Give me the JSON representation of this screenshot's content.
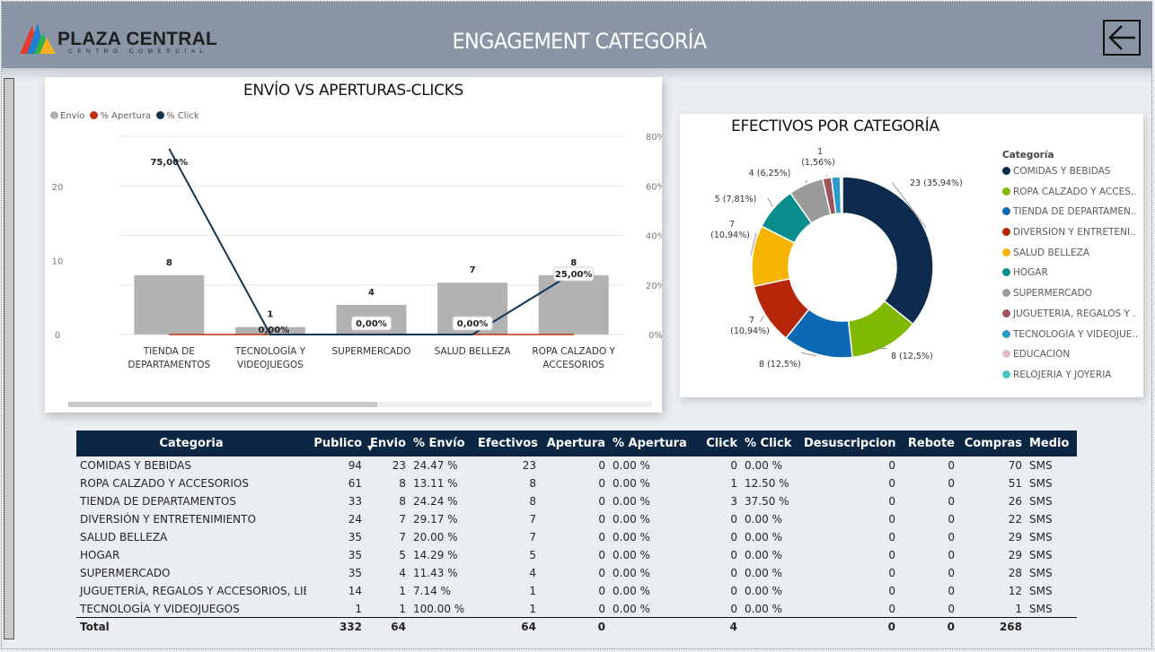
{
  "header": {
    "title": "ENGAGEMENT CATEGORÍA",
    "logo_name": "PLAZA CENTRAL",
    "logo_sub": "CENTRO COMERCIAL",
    "back_icon": "arrow-left-icon"
  },
  "colors": {
    "header_bg": "#8995a4",
    "navy": "#0c2744",
    "bar_gray": "#b2b2b2",
    "line_navy": "#0f3553"
  },
  "chart1": {
    "title": "ENVÍO VS APERTURAS-CLICKS",
    "legend": [
      {
        "label": "Envío",
        "color": "#b2b2b2"
      },
      {
        "label": "% Apertura",
        "color": "#c02d11"
      },
      {
        "label": "% Click",
        "color": "#0f3553"
      }
    ]
  },
  "chart2": {
    "title": "EFECTIVOS POR CATEGORÍA",
    "legend_title": "Categoría",
    "legend": [
      {
        "label": "COMIDAS Y BEBIDAS",
        "color": "#0d2b4d"
      },
      {
        "label": "ROPA CALZADO Y ACCES...",
        "color": "#7fba00"
      },
      {
        "label": "TIENDA DE DEPARTAMEN...",
        "color": "#0c6ab5"
      },
      {
        "label": "DIVERSIÓN Y ENTRETENI...",
        "color": "#b8260a"
      },
      {
        "label": "SALUD BELLEZA",
        "color": "#f5b400"
      },
      {
        "label": "HOGAR",
        "color": "#0a8d8d"
      },
      {
        "label": "SUPERMERCADO",
        "color": "#9a9a9a"
      },
      {
        "label": "JUGUETERÍA, REGALOS Y ...",
        "color": "#9b545b"
      },
      {
        "label": "TECNOLOGÍA Y VIDEOJUE...",
        "color": "#2a9bcd"
      },
      {
        "label": "EDUCACIÓN",
        "color": "#e3bcc4"
      },
      {
        "label": "RELOJERIA Y JOYERIA",
        "color": "#4bc5c2"
      }
    ]
  },
  "chart_data": [
    {
      "type": "bar",
      "title": "ENVÍO VS APERTURAS-CLICKS",
      "categories": [
        "TIENDA DE DEPARTAMENTOS",
        "TECNOLOGÍA Y VIDEOJUEGOS",
        "SUPERMERCADO",
        "SALUD BELLEZA",
        "ROPA CALZADO Y ACCESORIOS"
      ],
      "category_lines": [
        [
          "TIENDA DE",
          "DEPARTAMENTOS"
        ],
        [
          "TECNOLOGÍA Y",
          "VIDEOJUEGOS"
        ],
        [
          "SUPERMERCADO"
        ],
        [
          "SALUD BELLEZA"
        ],
        [
          "ROPA CALZADO Y",
          "ACCESORIOS"
        ]
      ],
      "series": [
        {
          "name": "Envío",
          "type": "bar",
          "axis": "left",
          "values": [
            8,
            1,
            4,
            7,
            8
          ],
          "labels": [
            "8",
            "1",
            "4",
            "7",
            "8"
          ]
        },
        {
          "name": "% Apertura",
          "type": "line",
          "axis": "right",
          "values": [
            0,
            0,
            0,
            0,
            0
          ]
        },
        {
          "name": "% Click",
          "type": "line",
          "axis": "right",
          "values": [
            75,
            0,
            0,
            0,
            25
          ],
          "labels": [
            "75,00%",
            "0,00%",
            "0,00%",
            "0,00%",
            "25,00%"
          ]
        }
      ],
      "y_left": {
        "ticks": [
          "0",
          "10",
          "20"
        ],
        "values": [
          0,
          10,
          20
        ],
        "range": [
          0,
          27
        ]
      },
      "y_right": {
        "ticks": [
          "0%",
          "20%",
          "40%",
          "60%",
          "80%"
        ],
        "values": [
          0,
          20,
          40,
          60,
          80
        ],
        "range": [
          0,
          80
        ]
      },
      "legend_position": "top-left",
      "grid": true
    },
    {
      "type": "pie",
      "title": "EFECTIVOS POR CATEGORÍA",
      "donut": true,
      "slices": [
        {
          "label": "COMIDAS Y BEBIDAS",
          "value": 23,
          "text": "23 (35,94%)"
        },
        {
          "label": "ROPA CALZADO Y ACCESORIOS",
          "value": 8,
          "text": "8 (12,5%)"
        },
        {
          "label": "TIENDA DE DEPARTAMENTOS",
          "value": 8,
          "text": "8 (12,5%)"
        },
        {
          "label": "DIVERSIÓN Y ENTRETENIMIENTO",
          "value": 7,
          "text": "7 (10,94%)"
        },
        {
          "label": "SALUD BELLEZA",
          "value": 7,
          "text": "7 (10,94%)"
        },
        {
          "label": "HOGAR",
          "value": 5,
          "text": "5 (7,81%)"
        },
        {
          "label": "SUPERMERCADO",
          "value": 4,
          "text": "4 (6,25%)"
        },
        {
          "label": "JUGUETERÍA, REGALOS Y ACCESORIOS, LIBROS",
          "value": 1,
          "text": "1 (1,56%)"
        },
        {
          "label": "TECNOLOGÍA Y VIDEOJUEGOS",
          "value": 1,
          "text": ""
        }
      ],
      "legend_position": "right"
    }
  ],
  "table": {
    "columns": [
      "Categoria",
      "Publico",
      "Envio",
      "% Envío",
      "Efectivos",
      "Apertura",
      "% Apertura",
      "Click",
      "% Click",
      "Desuscripcion",
      "Rebote",
      "Compras",
      "Medio"
    ],
    "sort_indicator": "▼",
    "rows": [
      [
        "COMIDAS Y BEBIDAS",
        "94",
        "23",
        "24.47 %",
        "23",
        "0",
        "0.00 %",
        "0",
        "0.00 %",
        "0",
        "0",
        "70",
        "SMS"
      ],
      [
        "ROPA CALZADO Y ACCESORIOS",
        "61",
        "8",
        "13.11 %",
        "8",
        "0",
        "0.00 %",
        "1",
        "12.50 %",
        "0",
        "0",
        "51",
        "SMS"
      ],
      [
        "TIENDA DE DEPARTAMENTOS",
        "33",
        "8",
        "24.24 %",
        "8",
        "0",
        "0.00 %",
        "3",
        "37.50 %",
        "0",
        "0",
        "26",
        "SMS"
      ],
      [
        "DIVERSIÓN Y ENTRETENIMIENTO",
        "24",
        "7",
        "29.17 %",
        "7",
        "0",
        "0.00 %",
        "0",
        "0.00 %",
        "0",
        "0",
        "22",
        "SMS"
      ],
      [
        "SALUD BELLEZA",
        "35",
        "7",
        "20.00 %",
        "7",
        "0",
        "0.00 %",
        "0",
        "0.00 %",
        "0",
        "0",
        "29",
        "SMS"
      ],
      [
        "HOGAR",
        "35",
        "5",
        "14.29 %",
        "5",
        "0",
        "0.00 %",
        "0",
        "0.00 %",
        "0",
        "0",
        "29",
        "SMS"
      ],
      [
        "SUPERMERCADO",
        "35",
        "4",
        "11.43 %",
        "4",
        "0",
        "0.00 %",
        "0",
        "0.00 %",
        "0",
        "0",
        "28",
        "SMS"
      ],
      [
        "JUGUETERÍA, REGALOS Y ACCESORIOS, LIBROS",
        "14",
        "1",
        "7.14 %",
        "1",
        "0",
        "0.00 %",
        "0",
        "0.00 %",
        "0",
        "0",
        "12",
        "SMS"
      ],
      [
        "TECNOLOGÍA Y VIDEOJUEGOS",
        "1",
        "1",
        "100.00 %",
        "1",
        "0",
        "0.00 %",
        "0",
        "0.00 %",
        "0",
        "0",
        "1",
        "SMS"
      ]
    ],
    "total": [
      "Total",
      "332",
      "64",
      "",
      "64",
      "0",
      "",
      "4",
      "",
      "0",
      "0",
      "268",
      ""
    ]
  }
}
